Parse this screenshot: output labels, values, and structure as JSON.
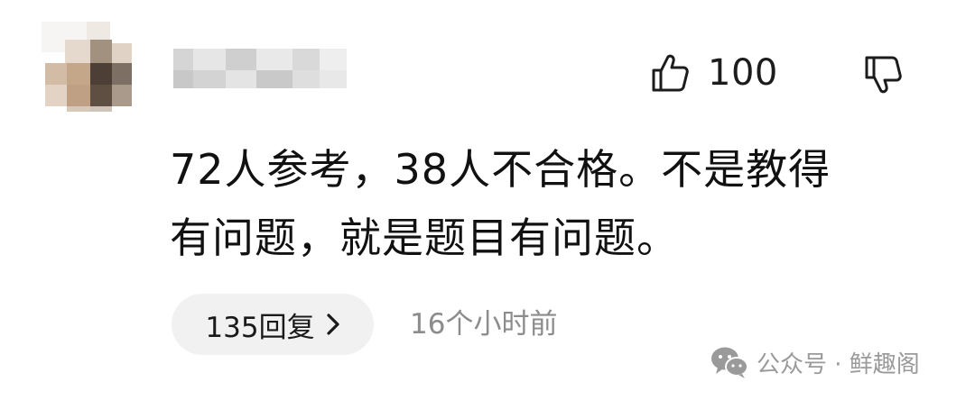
{
  "comment": {
    "likes": "100",
    "lines": [
      "72人参考，38人不合格。不是教得",
      "有问题，就是题目有问题。"
    ],
    "reply_label": "135回复",
    "time_ago": "16个小时前"
  },
  "watermark": {
    "text": "公众号 · 鲜趣阁"
  },
  "icons": {
    "like": "thumbs-up-icon",
    "dislike": "thumbs-down-icon",
    "reply_chevron": "chevron-right-icon",
    "watermark": "wechat-icon"
  },
  "colors": {
    "text": "#111111",
    "secondary_text": "#8c8c8c",
    "pill_background": "#f1f1f1",
    "watermark": "#9a9a9a"
  }
}
